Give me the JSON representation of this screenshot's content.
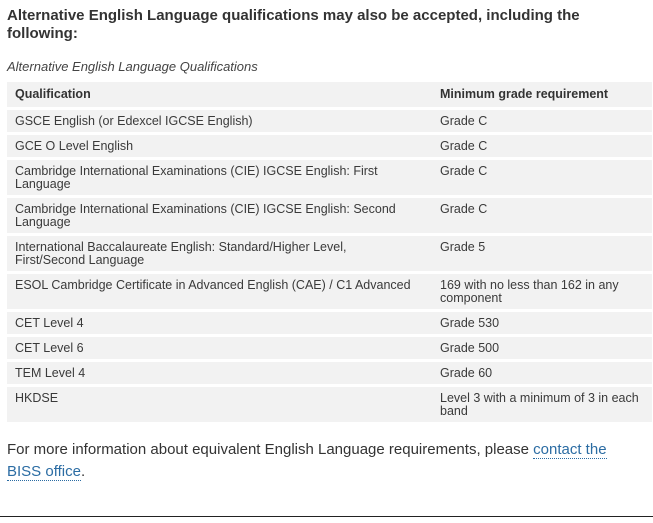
{
  "intro": "Alternative English Language qualifications may also be accepted, including the following:",
  "table": {
    "caption": "Alternative English Language Qualifications",
    "headers": [
      "Qualification",
      "Minimum grade requirement"
    ],
    "rows": [
      [
        "GSCE English (or Edexcel IGCSE English)",
        "Grade C"
      ],
      [
        "GCE O Level English",
        "Grade C"
      ],
      [
        "Cambridge International Examinations (CIE) IGCSE English: First Language",
        "Grade C"
      ],
      [
        "Cambridge International Examinations (CIE) IGCSE English: Second Language",
        "Grade C"
      ],
      [
        "International Baccalaureate English: Standard/Higher Level, First/Second Language",
        "Grade 5"
      ],
      [
        "ESOL Cambridge Certificate in Advanced English (CAE) / C1 Advanced",
        "169 with no less than 162 in any component"
      ],
      [
        "CET Level 4",
        "Grade 530"
      ],
      [
        "CET Level 6",
        "Grade 500"
      ],
      [
        "TEM Level 4",
        "Grade 60"
      ],
      [
        "HKDSE",
        "Level 3 with a minimum of 3 in each band"
      ]
    ]
  },
  "footer": {
    "text_before": "For more information about equivalent English Language requirements, please ",
    "link_text": "contact the BISS office",
    "text_after": ".",
    "link_color": "#2b6ca3"
  }
}
